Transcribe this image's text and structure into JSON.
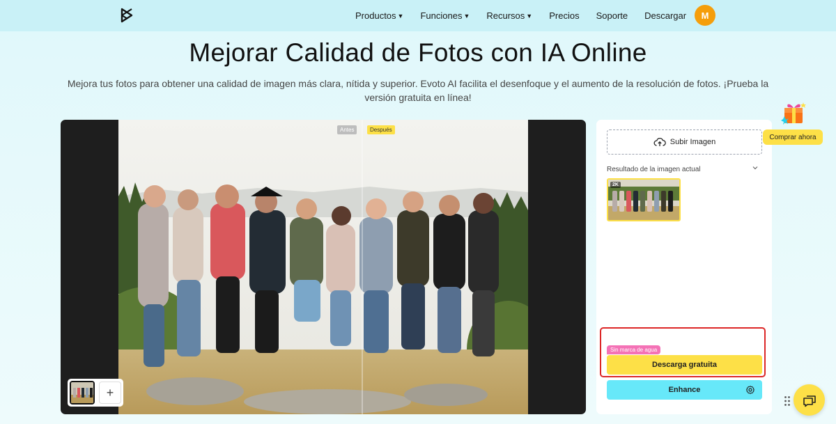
{
  "nav": {
    "items": [
      {
        "label": "Productos",
        "has_caret": true
      },
      {
        "label": "Funciones",
        "has_caret": true
      },
      {
        "label": "Recursos",
        "has_caret": true
      },
      {
        "label": "Precios",
        "has_caret": false
      },
      {
        "label": "Soporte",
        "has_caret": false
      },
      {
        "label": "Descargar",
        "has_caret": false
      }
    ],
    "avatar_initial": "M",
    "caret_glyph": "▼"
  },
  "hero": {
    "title": "Mejorar Calidad de Fotos con IA Online",
    "subtitle": "Mejora tus fotos para obtener una calidad de imagen más clara, nítida y superior. Evoto AI facilita el desenfoque y el aumento de la resolución de fotos. ¡Prueba la versión gratuita en línea!"
  },
  "viewer": {
    "before_label": "Antes",
    "after_label": "Después",
    "add_glyph": "+"
  },
  "panel": {
    "upload_label": "Subir Imagen",
    "result_label": "Resultado de la imagen actual",
    "resolution_badge": "2K",
    "watermark_tag": "Sin marca de agua",
    "download_label": "Descarga gratuita",
    "enhance_label": "Enhance"
  },
  "promo": {
    "buy_label": "Comprar ahora"
  },
  "colors": {
    "accent_yellow": "#fde047",
    "accent_cyan": "#67e8f9",
    "avatar_orange": "#f59e0b",
    "highlight_red": "#dc2626",
    "tag_pink": "#f472b6"
  }
}
